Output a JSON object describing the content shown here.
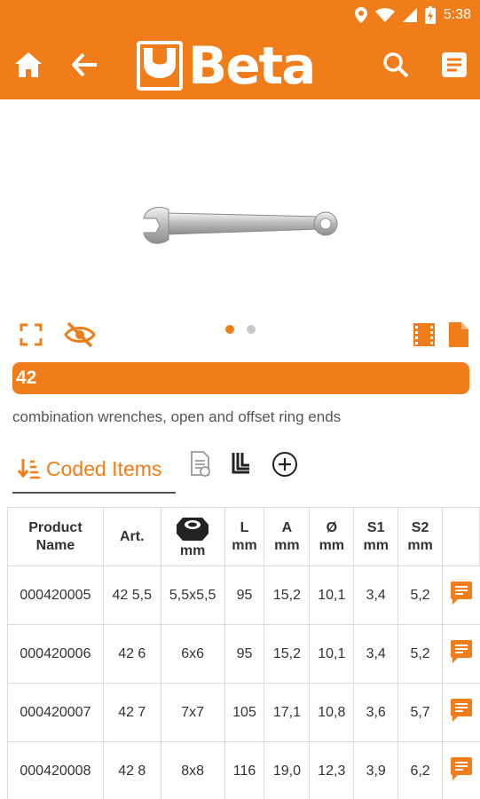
{
  "status": {
    "time": "5:38"
  },
  "app": {
    "brand": "Beta"
  },
  "product": {
    "code": "42",
    "description": "combination wrenches, open and offset ring ends",
    "image_count": 2,
    "active_image": 1
  },
  "tabs": {
    "active_label": "Coded Items"
  },
  "table": {
    "headers": [
      {
        "top": "Product",
        "bottom": "Name"
      },
      {
        "top": "Art.",
        "bottom": ""
      },
      {
        "top": "",
        "bottom": "mm"
      },
      {
        "top": "L",
        "bottom": "mm"
      },
      {
        "top": "A",
        "bottom": "mm"
      },
      {
        "top": "Ø",
        "bottom": "mm"
      },
      {
        "top": "S1",
        "bottom": "mm"
      },
      {
        "top": "S2",
        "bottom": "mm"
      }
    ],
    "rows": [
      {
        "product": "000420005",
        "art": "42 5,5",
        "size": "5,5x5,5",
        "l": "95",
        "a": "15,2",
        "d": "10,1",
        "s1": "3,4",
        "s2": "5,2"
      },
      {
        "product": "000420006",
        "art": "42 6",
        "size": "6x6",
        "l": "95",
        "a": "15,2",
        "d": "10,1",
        "s1": "3,4",
        "s2": "5,2"
      },
      {
        "product": "000420007",
        "art": "42 7",
        "size": "7x7",
        "l": "105",
        "a": "17,1",
        "d": "10,8",
        "s1": "3,6",
        "s2": "5,7"
      },
      {
        "product": "000420008",
        "art": "42 8",
        "size": "8x8",
        "l": "116",
        "a": "19,0",
        "d": "12,3",
        "s1": "3,9",
        "s2": "6,2"
      }
    ]
  },
  "colors": {
    "accent": "#f07d1a",
    "icon_dark": "#333333"
  },
  "icons": [
    "location-icon",
    "wifi-icon",
    "signal-icon",
    "battery-icon",
    "home-icon",
    "back-arrow-icon",
    "search-icon",
    "notes-icon",
    "fullscreen-icon",
    "hide-eye-icon",
    "video-icon",
    "document-icon",
    "sort-down-icon",
    "spec-doc-icon",
    "hex-keys-icon",
    "add-circle-icon",
    "hex-nut-icon",
    "comment-icon"
  ]
}
